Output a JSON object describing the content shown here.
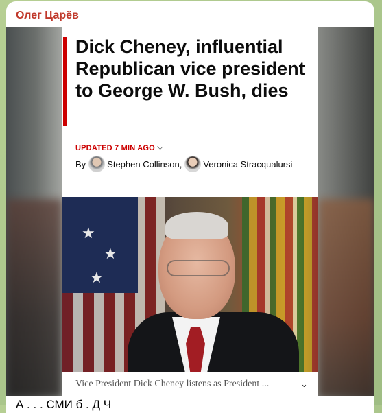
{
  "message": {
    "sender": "Олег Царёв",
    "text": "А . . . СМИ б . Д Ч"
  },
  "article": {
    "headline": "Dick Cheney, influential Republican vice president to George W. Bush, dies",
    "updated": "UPDATED 7 MIN AGO",
    "by_label": "By",
    "authors": [
      "Stephen Collinson",
      "Veronica Stracqualursi"
    ],
    "author_separator": ",",
    "caption": "Vice President Dick Cheney listens as President ...",
    "chevron_icon": "chevron-down-icon"
  },
  "colors": {
    "sender": "#c0392b",
    "accent_red": "#cc0000"
  }
}
